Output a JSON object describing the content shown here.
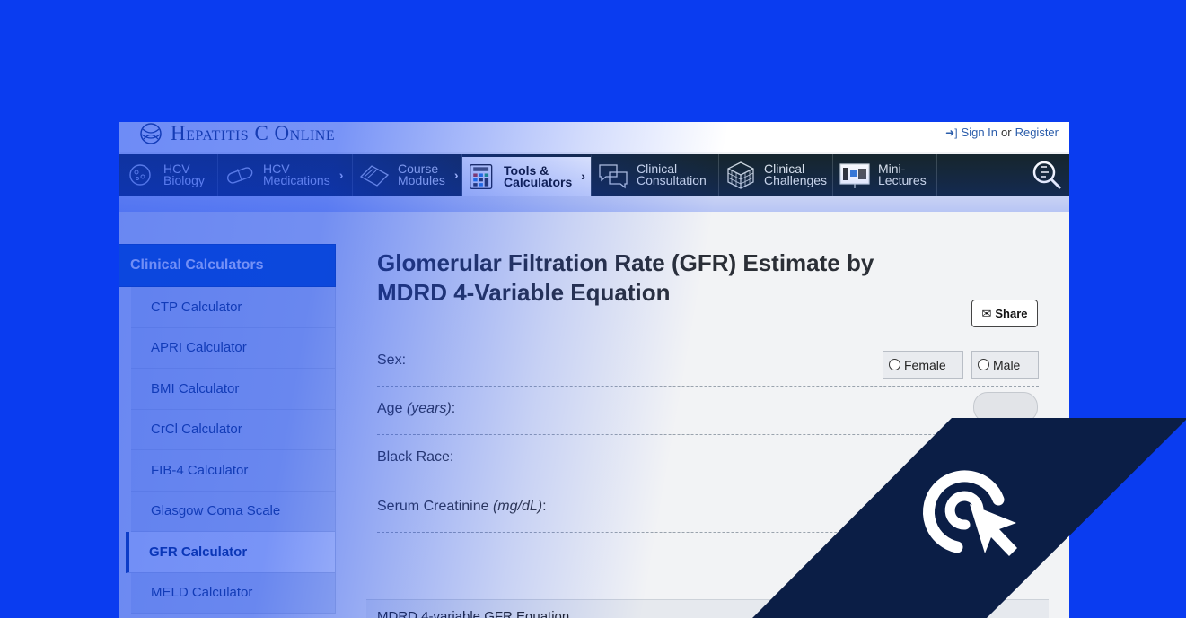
{
  "brand": {
    "name": "Hepatitis C Online"
  },
  "auth": {
    "sign_in": "Sign In",
    "or": "or",
    "register": "Register"
  },
  "nav": {
    "items": [
      {
        "line1": "HCV",
        "line2": "Biology",
        "icon": "virus-icon"
      },
      {
        "line1": "HCV",
        "line2": "Medications",
        "icon": "capsule-icon"
      },
      {
        "line1": "Course",
        "line2": "Modules",
        "icon": "book-icon"
      },
      {
        "line1": "Tools &",
        "line2": "Calculators",
        "icon": "calculator-icon"
      },
      {
        "line1": "Clinical",
        "line2": "Consultation",
        "icon": "chat-bubbles-icon"
      },
      {
        "line1": "Clinical",
        "line2": "Challenges",
        "icon": "cube-icon"
      },
      {
        "line1": "Mini-",
        "line2": "Lectures",
        "icon": "presentation-icon"
      }
    ]
  },
  "sidebar": {
    "heading": "Clinical Calculators",
    "items": [
      "CTP Calculator",
      "APRI Calculator",
      "BMI Calculator",
      "CrCl Calculator",
      "FIB-4 Calculator",
      "Glasgow Coma Scale",
      "GFR Calculator",
      "MELD Calculator"
    ],
    "active_index": 6
  },
  "main": {
    "title": "Glomerular Filtration Rate (GFR) Estimate by MDRD 4-Variable Equation",
    "share_label": "Share",
    "fields": {
      "sex": {
        "label": "Sex:",
        "options": [
          "Female",
          "Male"
        ]
      },
      "age": {
        "label": "Age ",
        "unit": "(years)",
        "suffix": ":"
      },
      "black_race": {
        "label": "Black Race:"
      },
      "serum_creatinine": {
        "label": "Serum Creatinine ",
        "unit": "(mg/dL)",
        "suffix": ":"
      }
    },
    "equation_heading": "MDRD 4-variable GFR Equation"
  },
  "colors": {
    "background_blue": "#0a3cf0",
    "nav_dark": "#16262f",
    "corner_navy": "#0b1e46"
  }
}
